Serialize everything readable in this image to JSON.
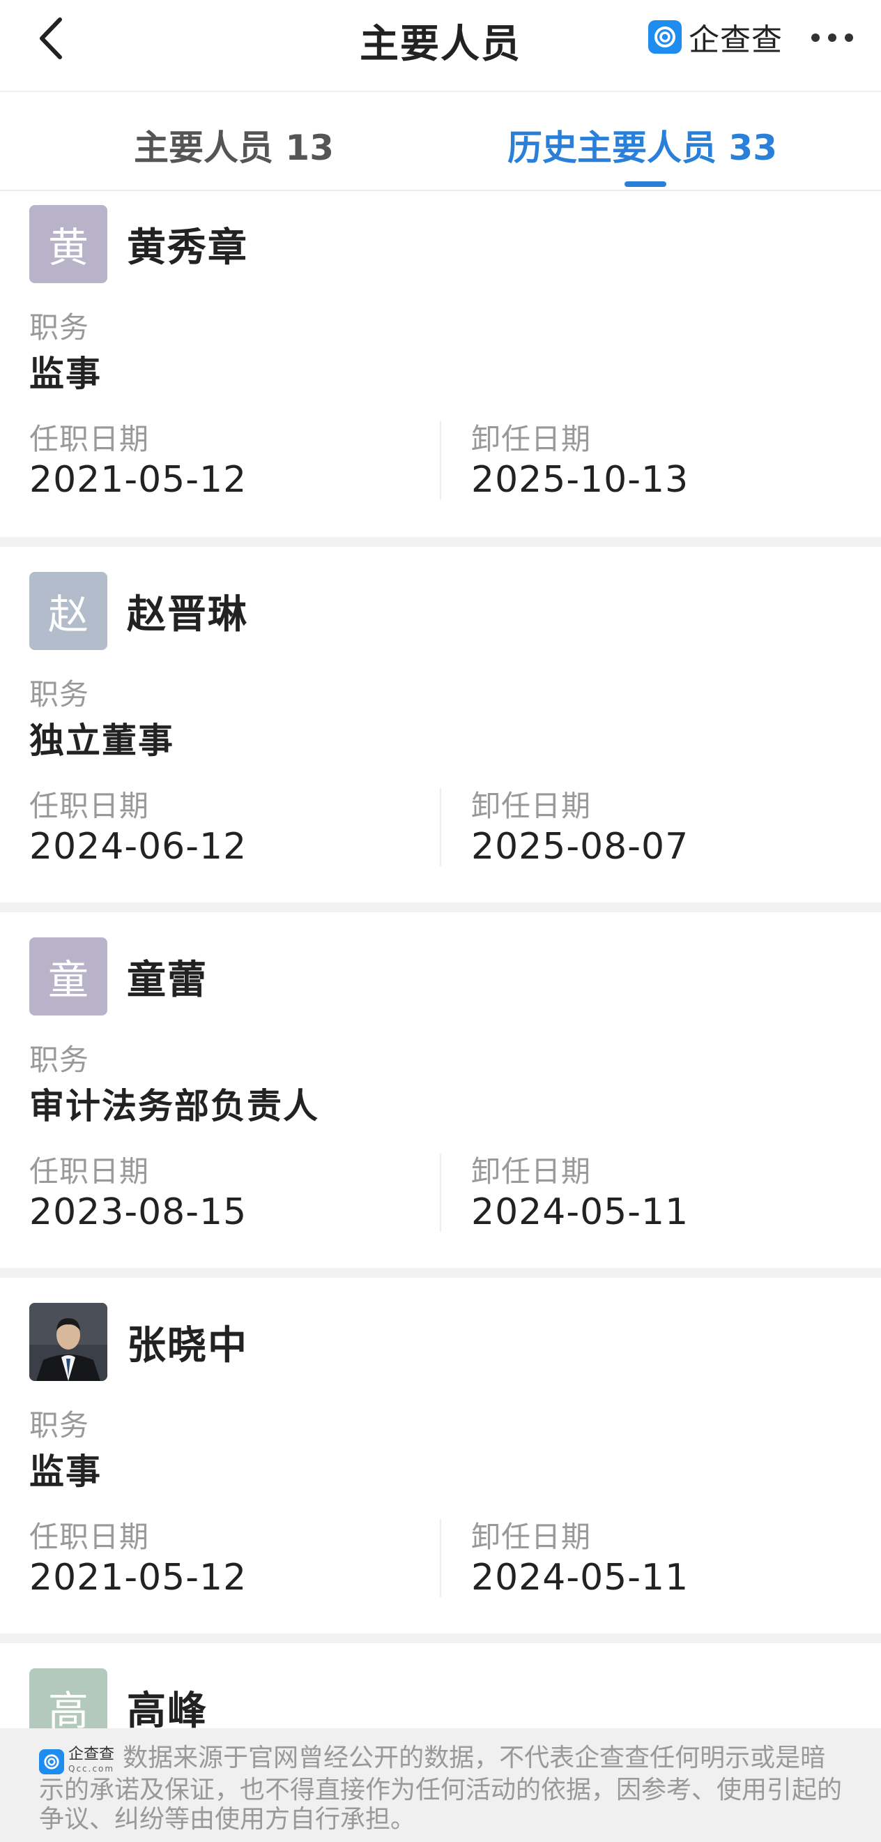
{
  "header": {
    "title": "主要人员",
    "brand_name": "企查查",
    "back_icon": "chevron-left-icon",
    "more_icon": "ellipsis-icon"
  },
  "tabs": [
    {
      "label": "主要人员 13",
      "active": false
    },
    {
      "label": "历史主要人员 33",
      "active": true
    }
  ],
  "labels": {
    "role": "职务",
    "start": "任职日期",
    "end": "卸任日期"
  },
  "people": [
    {
      "avatar_char": "黄",
      "avatar_color": "#b8b3c9",
      "name": "黄秀章",
      "role": "监事",
      "start": "2021-05-12",
      "end": "2025-10-13"
    },
    {
      "avatar_char": "赵",
      "avatar_color": "#b3bccb",
      "name": "赵晋琳",
      "role": "独立董事",
      "start": "2024-06-12",
      "end": "2025-08-07"
    },
    {
      "avatar_char": "童",
      "avatar_color": "#b9b3c9",
      "name": "童蕾",
      "role": "审计法务部负责人",
      "start": "2023-08-15",
      "end": "2024-05-11"
    },
    {
      "avatar_char": "",
      "avatar_color": "#3a3a3a",
      "name": "张晓中",
      "role": "监事",
      "start": "2021-05-12",
      "end": "2024-05-11"
    },
    {
      "avatar_char": "高",
      "avatar_color": "#b3c9bd",
      "name": "高峰"
    }
  ],
  "footer": {
    "brand_name": "企查查",
    "brand_domain": "Qcc.com",
    "disclaimer": "数据来源于官网曾经公开的数据，不代表企查查任何明示或是暗示的承诺及保证，也不得直接作为任何活动的依据，因参考、使用引起的争议、纠纷等由使用方自行承担。"
  }
}
